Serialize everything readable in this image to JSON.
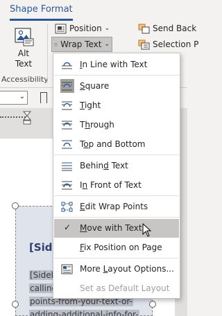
{
  "ribbon": {
    "tab": "Shape Format",
    "alt_text": {
      "line1": "Alt",
      "line2": "Text"
    },
    "group_label": "Accessibility",
    "position": "Position",
    "wrap_text": "Wrap Text",
    "send_back": "Send Back",
    "selection": "Selection P"
  },
  "sidebar": {
    "heading": "[Side",
    "lines": [
      "[Sideb",
      "calling",
      "points-from-your-text-or-",
      "adding-additional-info-for-"
    ]
  },
  "menu": {
    "items": [
      {
        "key": "I",
        "before": "",
        "after": "n Line with Text"
      },
      {
        "key": "S",
        "before": "",
        "after": "quare"
      },
      {
        "key": "T",
        "before": "",
        "after": "ight"
      },
      {
        "key": "h",
        "before": "T",
        "after": "rough"
      },
      {
        "key": "o",
        "before": "T",
        "after": "p and Bottom"
      },
      {
        "key": "d",
        "before": "Behin",
        "after": " Text"
      },
      {
        "key": "n",
        "before": "I",
        "after": " Front of Text"
      },
      {
        "key": "E",
        "before": "",
        "after": "dit Wrap Points"
      },
      {
        "key": "M",
        "before": "",
        "after": "ove with Text"
      },
      {
        "key": "F",
        "before": "",
        "after": "ix Position on Page"
      },
      {
        "key": "L",
        "before": "More ",
        "after": "ayout Options..."
      },
      {
        "key": "",
        "before": "Set as Default Layout",
        "after": ""
      }
    ]
  },
  "colors": {
    "accent": "#2b579a",
    "hover": "#c8c6c4",
    "disabled": "#a19f9d"
  }
}
